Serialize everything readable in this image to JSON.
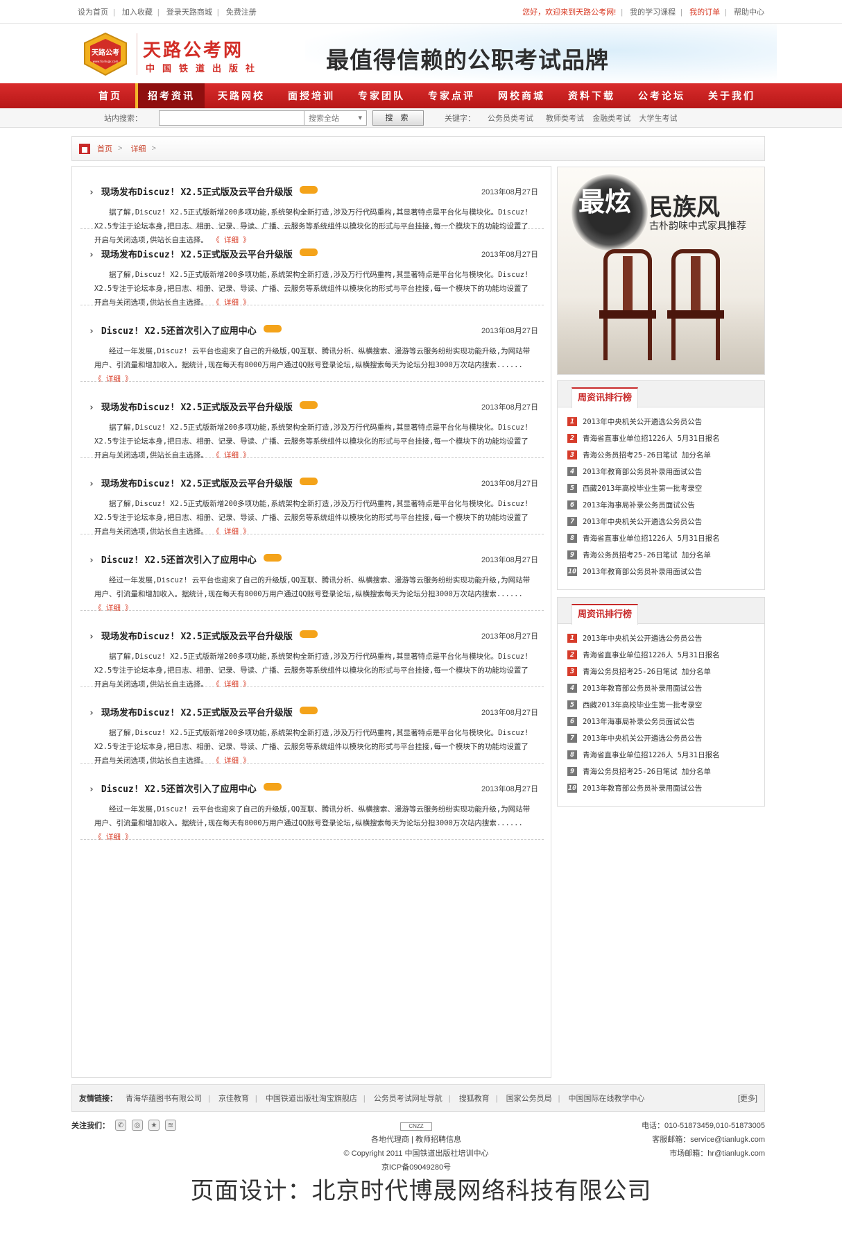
{
  "topbar": {
    "left_links": [
      "设为首页",
      "加入收藏",
      "登录天路商城",
      "免费注册"
    ],
    "welcome": "您好，欢迎来到天路公考网!",
    "right_links": [
      "我的学习课程",
      "我的订单",
      "帮助中心"
    ]
  },
  "header": {
    "logo_badge": "天路公考",
    "logo_url": "www.tianlugk.com",
    "site_name": "天路公考网",
    "publisher": "中国铁道出版社",
    "slogan": "最值得信赖的公职考试品牌"
  },
  "nav": {
    "items": [
      "首页",
      "招考资讯",
      "天路网校",
      "面授培训",
      "专家团队",
      "专家点评",
      "网校商城",
      "资料下载",
      "公考论坛",
      "关于我们"
    ],
    "active_index": 1
  },
  "search": {
    "label": "站内搜索：",
    "input_value": "",
    "scope": "搜索全站",
    "button": "搜 索",
    "keywords_label": "关键字：",
    "keywords": [
      "公务员类考试",
      "教师类考试",
      "金融类考试",
      "大学生考试"
    ]
  },
  "breadcrumb": [
    "首页",
    "详细"
  ],
  "articles": [
    {
      "title": "现场发布Discuz! X2.5正式版及云平台升级版",
      "date": "2013年08月27日",
      "body": "据了解,Discuz! X2.5正式版新增200多项功能,系统架构全新打造,涉及万行代码重构,其显著特点是平台化与模块化。Discuz! X2.5专注于论坛本身,把日志、相册、记录、导读、广播、云服务等系统组件以模块化的形式与平台挂接,每一个模块下的功能均设置了开启与关闭选项,供站长自主选择。",
      "more": "《 详细 》"
    },
    {
      "title": "现场发布Discuz! X2.5正式版及云平台升级版",
      "date": "2013年08月27日",
      "body": "据了解,Discuz! X2.5正式版新增200多项功能,系统架构全新打造,涉及万行代码重构,其显著特点是平台化与模块化。Discuz! X2.5专注于论坛本身,把日志、相册、记录、导读、广播、云服务等系统组件以模块化的形式与平台挂接,每一个模块下的功能均设置了开启与关闭选项,供站长自主选择。",
      "more": "《 详细 》"
    },
    {
      "title": "Discuz! X2.5还首次引入了应用中心",
      "date": "2013年08月27日",
      "body": "经过一年发展,Discuz! 云平台也迎来了自己的升级版,QQ互联、腾讯分析、纵横搜索、漫游等云服务纷纷实现功能升级,为网站带用户、引流量和增加收入。据统计,现在每天有8000万用户通过QQ账号登录论坛,纵横搜索每天为论坛分担3000万次站内搜索......",
      "more": "《 详细 》"
    },
    {
      "title": "现场发布Discuz! X2.5正式版及云平台升级版",
      "date": "2013年08月27日",
      "body": "据了解,Discuz! X2.5正式版新增200多项功能,系统架构全新打造,涉及万行代码重构,其显著特点是平台化与模块化。Discuz! X2.5专注于论坛本身,把日志、相册、记录、导读、广播、云服务等系统组件以模块化的形式与平台挂接,每一个模块下的功能均设置了开启与关闭选项,供站长自主选择。",
      "more": "《 详细 》"
    },
    {
      "title": "现场发布Discuz! X2.5正式版及云平台升级版",
      "date": "2013年08月27日",
      "body": "据了解,Discuz! X2.5正式版新增200多项功能,系统架构全新打造,涉及万行代码重构,其显著特点是平台化与模块化。Discuz! X2.5专注于论坛本身,把日志、相册、记录、导读、广播、云服务等系统组件以模块化的形式与平台挂接,每一个模块下的功能均设置了开启与关闭选项,供站长自主选择。",
      "more": "《 详细 》"
    },
    {
      "title": "Discuz! X2.5还首次引入了应用中心",
      "date": "2013年08月27日",
      "body": "经过一年发展,Discuz! 云平台也迎来了自己的升级版,QQ互联、腾讯分析、纵横搜索、漫游等云服务纷纷实现功能升级,为网站带用户、引流量和增加收入。据统计,现在每天有8000万用户通过QQ账号登录论坛,纵横搜索每天为论坛分担3000万次站内搜索......",
      "more": "《 详细 》"
    },
    {
      "title": "现场发布Discuz! X2.5正式版及云平台升级版",
      "date": "2013年08月27日",
      "body": "据了解,Discuz! X2.5正式版新增200多项功能,系统架构全新打造,涉及万行代码重构,其显著特点是平台化与模块化。Discuz! X2.5专注于论坛本身,把日志、相册、记录、导读、广播、云服务等系统组件以模块化的形式与平台挂接,每一个模块下的功能均设置了开启与关闭选项,供站长自主选择。",
      "more": "《 详细 》"
    },
    {
      "title": "现场发布Discuz! X2.5正式版及云平台升级版",
      "date": "2013年08月27日",
      "body": "据了解,Discuz! X2.5正式版新增200多项功能,系统架构全新打造,涉及万行代码重构,其显著特点是平台化与模块化。Discuz! X2.5专注于论坛本身,把日志、相册、记录、导读、广播、云服务等系统组件以模块化的形式与平台挂接,每一个模块下的功能均设置了开启与关闭选项,供站长自主选择。",
      "more": "《 详细 》"
    },
    {
      "title": "Discuz! X2.5还首次引入了应用中心",
      "date": "2013年08月27日",
      "body": "经过一年发展,Discuz! 云平台也迎来了自己的升级版,QQ互联、腾讯分析、纵横搜索、漫游等云服务纷纷实现功能升级,为网站带用户、引流量和增加收入。据统计,现在每天有8000万用户通过QQ账号登录论坛,纵横搜索每天为论坛分担3000万次站内搜索......",
      "more": "《 详细 》"
    }
  ],
  "ad": {
    "badge": "最炫",
    "title": "民族风",
    "subtitle": "古朴韵味中式家具推荐"
  },
  "rankings": [
    {
      "title": "周资讯排行榜",
      "items": [
        "2013年中央机关公开遴选公务员公告",
        "青海省直事业单位招1226人 5月31日报名",
        "青海公务员招考25-26日笔试 加分名单",
        "2013年教育部公务员补录用面试公告",
        "西藏2013年高校毕业生第一批考录空",
        "2013年海事局补录公务员面试公告",
        "2013年中央机关公开遴选公务员公告",
        "青海省直事业单位招1226人 5月31日报名",
        "青海公务员招考25-26日笔试 加分名单",
        "2013年教育部公务员补录用面试公告"
      ]
    },
    {
      "title": "周资讯排行榜",
      "items": [
        "2013年中央机关公开遴选公务员公告",
        "青海省直事业单位招1226人 5月31日报名",
        "青海公务员招考25-26日笔试 加分名单",
        "2013年教育部公务员补录用面试公告",
        "西藏2013年高校毕业生第一批考录空",
        "2013年海事局补录公务员面试公告",
        "2013年中央机关公开遴选公务员公告",
        "青海省直事业单位招1226人 5月31日报名",
        "青海公务员招考25-26日笔试 加分名单",
        "2013年教育部公务员补录用面试公告"
      ]
    }
  ],
  "friend_links": {
    "label": "友情链接：",
    "items": [
      "青海华蕴图书有限公司",
      "京佳教育",
      "中国铁道出版社淘宝旗舰店",
      "公务员考试网址导航",
      "搜狐教育",
      "国家公务员局",
      "中国国际在线教学中心"
    ],
    "more": "[更多]"
  },
  "footer": {
    "follow_label": "关注我们：",
    "cnzz": "CNZZ",
    "links": [
      "各地代理商",
      "教师招聘信息"
    ],
    "copyright": "© Copyright 2011 中国铁道出版社培训中心",
    "icp": "京ICP备09049280号",
    "phone": "电话：010-51873459,010-51873005",
    "service_email": "客服邮箱：service@tianlugk.com",
    "market_email": "市场邮箱：hr@tianlugk.com"
  },
  "designer": "页面设计：北京时代博晟网络科技有限公司",
  "colors": {
    "brand_red": "#c82a2a",
    "nav_red": "#d92c2c",
    "link_red": "#d93b25",
    "new_badge": "#f4a31a"
  }
}
